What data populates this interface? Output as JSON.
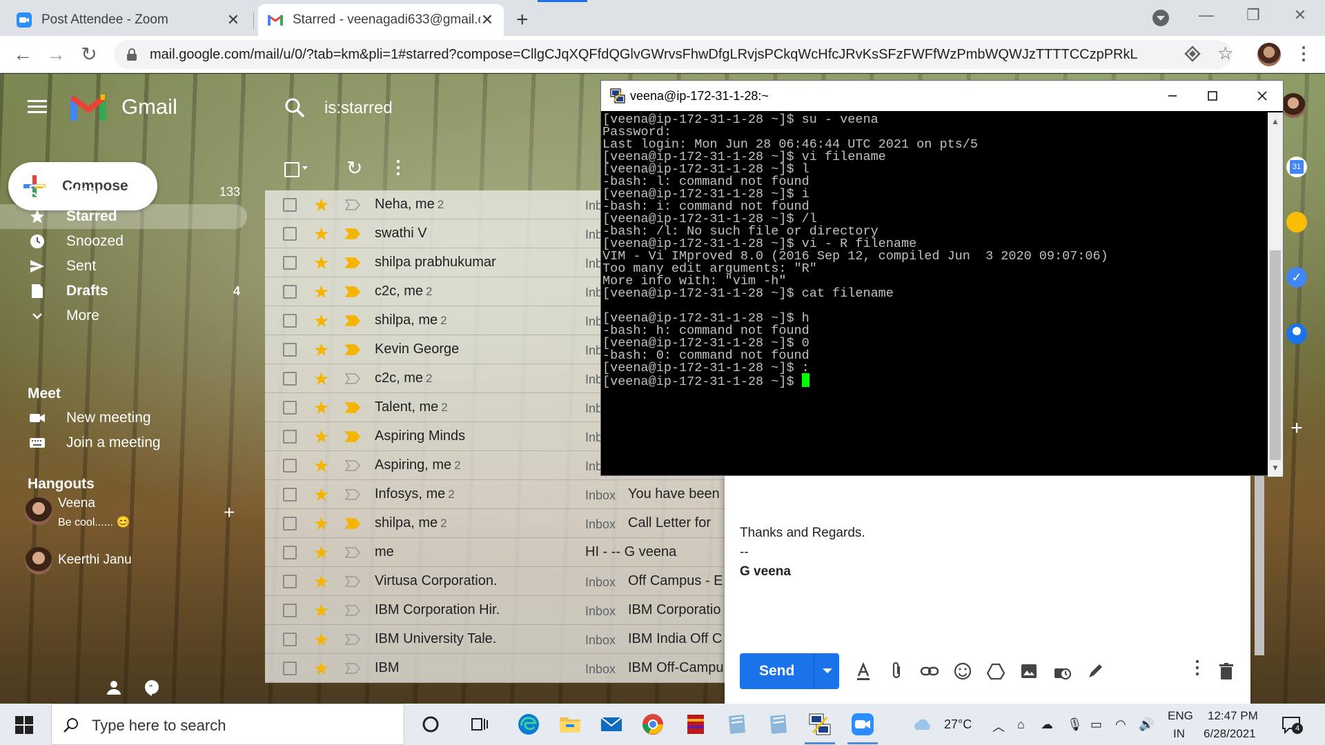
{
  "browser": {
    "tabs": [
      {
        "title": "Post Attendee - Zoom",
        "icon": "zoom-icon",
        "active": false
      },
      {
        "title": "Starred - veenagadi633@gmail.c",
        "icon": "gmail-icon",
        "active": true
      }
    ],
    "new_tab": "+",
    "url": "mail.google.com/mail/u/0/?tab=km&pli=1#starred?compose=CllgCJqXQFfdQGlvGWrvsFhwDfgLRvjsPCkqWcHfcJRvKsSFzFWFfWzPmbWQWJzTTTTCCzpPRkL"
  },
  "gmail": {
    "wordmark": "Gmail",
    "search_query": "is:starred",
    "compose_label": "Compose",
    "nav": [
      {
        "label": "Inbox",
        "count": "133",
        "icon": "inbox-icon",
        "bold": true
      },
      {
        "label": "Starred",
        "count": "",
        "icon": "star-icon",
        "bold": true,
        "active": true
      },
      {
        "label": "Snoozed",
        "count": "",
        "icon": "clock-icon",
        "bold": false
      },
      {
        "label": "Sent",
        "count": "",
        "icon": "send-icon",
        "bold": false
      },
      {
        "label": "Drafts",
        "count": "4",
        "icon": "draft-icon",
        "bold": true
      },
      {
        "label": "More",
        "count": "",
        "icon": "chevron-down-icon",
        "bold": false
      }
    ],
    "meet": {
      "title": "Meet",
      "items": [
        {
          "label": "New meeting",
          "icon": "video-icon"
        },
        {
          "label": "Join a meeting",
          "icon": "keyboard-icon"
        }
      ]
    },
    "hangouts": {
      "title": "Hangouts",
      "contacts": [
        {
          "name": "Veena",
          "status": "Be cool......"
        },
        {
          "name": "Keerthi Janu",
          "status": ""
        }
      ]
    },
    "mails": [
      {
        "sender": "Neha, me",
        "count": "2",
        "label": "Inb",
        "subject": "",
        "important": false
      },
      {
        "sender": "swathi V",
        "count": "",
        "label": "Inb",
        "subject": "",
        "important": true
      },
      {
        "sender": "shilpa prabhukumar",
        "count": "",
        "label": "Inb",
        "subject": "",
        "important": true
      },
      {
        "sender": "c2c, me",
        "count": "2",
        "label": "Inb",
        "subject": "",
        "important": true
      },
      {
        "sender": "shilpa, me",
        "count": "2",
        "label": "Inb",
        "subject": "",
        "important": true
      },
      {
        "sender": "Kevin George",
        "count": "",
        "label": "Inb",
        "subject": "",
        "important": true
      },
      {
        "sender": "c2c, me",
        "count": "2",
        "label": "Inb",
        "subject": "",
        "important": false
      },
      {
        "sender": "Talent, me",
        "count": "2",
        "label": "Inb",
        "subject": "",
        "important": true
      },
      {
        "sender": "Aspiring Minds",
        "count": "",
        "label": "Inb",
        "subject": "",
        "important": true
      },
      {
        "sender": "Aspiring, me",
        "count": "2",
        "label": "Inb",
        "subject": "",
        "important": false
      },
      {
        "sender": "Infosys, me",
        "count": "2",
        "label": "Inbox",
        "subject": "You have been",
        "important": false
      },
      {
        "sender": "shilpa, me",
        "count": "2",
        "label": "Inbox",
        "subject": "Call Letter for",
        "important": true
      },
      {
        "sender": "me",
        "count": "",
        "label": "",
        "subject": "HI - -- G veena",
        "important": false
      },
      {
        "sender": "Virtusa Corporation.",
        "count": "",
        "label": "Inbox",
        "subject": "Off Campus - E",
        "important": false
      },
      {
        "sender": "IBM Corporation Hir.",
        "count": "",
        "label": "Inbox",
        "subject": "IBM Corporatio",
        "important": false
      },
      {
        "sender": "IBM University Tale.",
        "count": "",
        "label": "Inbox",
        "subject": "IBM India Off C",
        "important": false
      },
      {
        "sender": "IBM",
        "count": "",
        "label": "Inbox",
        "subject": "IBM Off-Campu",
        "important": false
      }
    ],
    "compose_window": {
      "signature_thanks": "Thanks and Regards.",
      "signature_dash": "--",
      "signature_name": "G veena",
      "send_label": "Send"
    }
  },
  "terminal": {
    "title": "veena@ip-172-31-1-28:~",
    "lines": [
      "[veena@ip-172-31-1-28 ~]$ su - veena",
      "Password:",
      "Last login: Mon Jun 28 06:46:44 UTC 2021 on pts/5",
      "[veena@ip-172-31-1-28 ~]$ vi filename",
      "[veena@ip-172-31-1-28 ~]$ l",
      "-bash: l: command not found",
      "[veena@ip-172-31-1-28 ~]$ i",
      "-bash: i: command not found",
      "[veena@ip-172-31-1-28 ~]$ /l",
      "-bash: /l: No such file or directory",
      "[veena@ip-172-31-1-28 ~]$ vi - R filename",
      "VIM - Vi IMproved 8.0 (2016 Sep 12, compiled Jun  3 2020 09:07:06)",
      "Too many edit arguments: \"R\"",
      "More info with: \"vim -h\"",
      "[veena@ip-172-31-1-28 ~]$ cat filename",
      "",
      "[veena@ip-172-31-1-28 ~]$ h",
      "-bash: h: command not found",
      "[veena@ip-172-31-1-28 ~]$ 0",
      "-bash: 0: command not found",
      "[veena@ip-172-31-1-28 ~]$ :",
      "[veena@ip-172-31-1-28 ~]$ "
    ]
  },
  "taskbar": {
    "search_placeholder": "Type here to search",
    "weather": "27°C",
    "lang_line1": "ENG",
    "lang_line2": "IN",
    "time": "12:47 PM",
    "date": "6/28/2021",
    "notification_count": "4"
  },
  "colors": {
    "accent": "#1a73e8",
    "star": "#f4b400",
    "cursor": "#00ff00"
  }
}
